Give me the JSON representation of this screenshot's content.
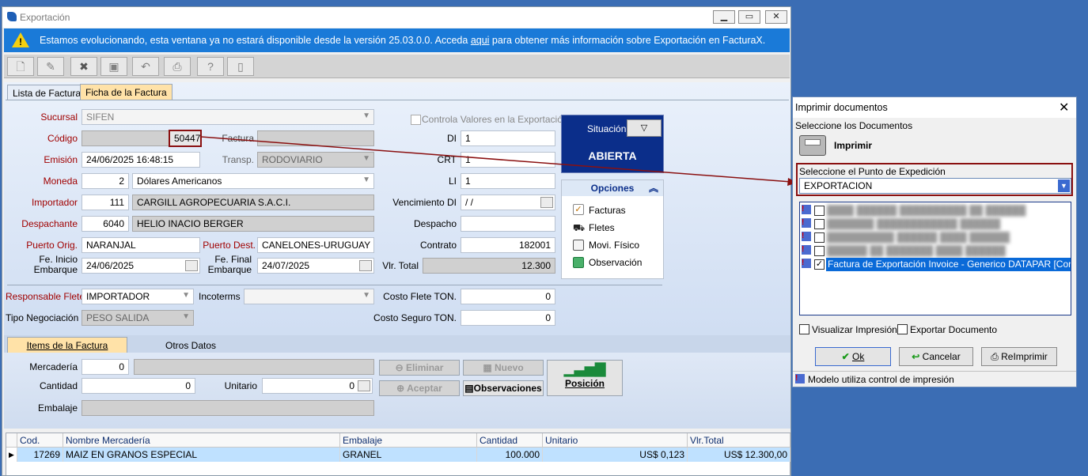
{
  "window": {
    "title": "Exportación"
  },
  "banner": {
    "message_pre": "Estamos evolucionando, esta ventana ya no estará disponible desde la versión 25.03.0.0. Acceda ",
    "link": "aqui",
    "message_post": " para obtener más información sobre Exportación en FacturaX."
  },
  "tabs": {
    "list": "Lista de Facturas",
    "detail": "Ficha de la Factura"
  },
  "form": {
    "sucursal_label": "Sucursal",
    "sucursal": "SIFEN",
    "codigo_label": "Código",
    "codigo": "50447",
    "factura_label": "Factura",
    "emision_label": "Emisión",
    "emision": "24/06/2025 16:48:15",
    "transp_label": "Transp.",
    "transp": "RODOVIARIO",
    "moneda_label": "Moneda",
    "moneda_code": "2",
    "moneda": "Dólares Americanos",
    "importador_label": "Importador",
    "importador_code": "111",
    "importador": "CARGILL AGROPECUARIA S.A.C.I.",
    "despachante_label": "Despachante",
    "despachante_code": "6040",
    "despachante": "HELIO INACIO BERGER",
    "puerto_orig_label": "Puerto Orig.",
    "puerto_orig": "NARANJAL",
    "puerto_dest_label": "Puerto Dest.",
    "puerto_dest": "CANELONES-URUGUAY",
    "fe_inicio_label1": "Fe. Inicio",
    "fe_inicio_label2": "Embarque",
    "fe_inicio": "24/06/2025",
    "fe_final_label1": "Fe. Final",
    "fe_final_label2": "Embarque",
    "fe_final": "24/07/2025",
    "controla_label": "Controla Valores en la Exportación",
    "di_label": "DI",
    "di": "1",
    "crt_label": "CRT",
    "crt": "1",
    "li_label": "LI",
    "li": "1",
    "venc_label": "Vencimiento DI",
    "venc": " /  /",
    "despacho_label": "Despacho",
    "contrato_label": "Contrato",
    "contrato": "182001",
    "vlr_total_label": "Vlr. Total",
    "vlr_total": "12.300",
    "resp_flete_label": "Responsable Flete",
    "resp_flete": "IMPORTADOR",
    "incoterms_label": "Incoterms",
    "tipo_neg_label": "Tipo Negociación",
    "tipo_neg": "PESO SALIDA",
    "costo_flete_label": "Costo Flete TON.",
    "costo_flete": "0",
    "costo_seguro_label": "Costo Seguro TON.",
    "costo_seguro": "0"
  },
  "situacion": {
    "label": "Situación",
    "state": "ABIERTA"
  },
  "opciones": {
    "title": "Opciones",
    "items": [
      "Facturas",
      "Fletes",
      "Movi. Físico",
      "Observación"
    ]
  },
  "subtabs": {
    "items": "Items de la Factura",
    "otros": "Otros Datos"
  },
  "items": {
    "mercaderia_label": "Mercadería",
    "mercaderia": "0",
    "cantidad_label": "Cantidad",
    "cantidad": "0",
    "unitario_label": "Unitario",
    "unitario": "0",
    "embalaje_label": "Embalaje",
    "eliminar": "Eliminar",
    "nuevo": "Nuevo",
    "aceptar": "Aceptar",
    "observaciones": "Observaciones",
    "posicion": "Posición"
  },
  "grid": {
    "headers": [
      "Cod.",
      "Nombre Mercadería",
      "Embalaje",
      "Cantidad",
      "Unitario",
      "Vlr.Total"
    ],
    "rows": [
      [
        "17269",
        "MAIZ EN GRANOS ESPECIAL",
        "GRANEL",
        "100.000",
        "US$ 0,123",
        "US$ 12.300,00"
      ]
    ]
  },
  "dialog": {
    "title": "Imprimir documentos",
    "select_docs": "Seleccione los Documentos",
    "imprimir": "Imprimir",
    "punto_label": "Seleccione el Punto de Expedición",
    "punto": "EXPORTACION",
    "docs": [
      "Factura de Exportación Invoice - Generico DATAPAR [Control Im"
    ],
    "visualizar": "Visualizar Impresión",
    "exportar": "Exportar Documento",
    "ok": "Ok",
    "cancelar": "Cancelar",
    "reimprimir": "ReImprimir",
    "status": "Modelo utiliza control de impresión"
  },
  "colors": {
    "banner": "#1a7ad8",
    "situacion_bg": "#0b2e8a",
    "grid_selected": "#bfe1ff",
    "highlight": "#a00000"
  }
}
